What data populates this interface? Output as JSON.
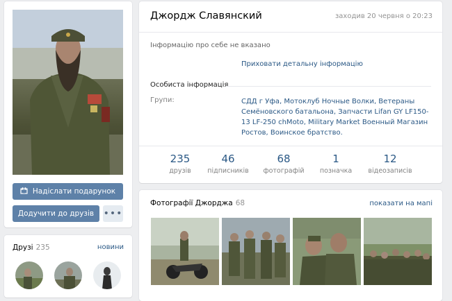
{
  "profile": {
    "name": "Джордж Славянский",
    "last_seen": "заходив 20 червня о 20:23",
    "no_info": "Інформацію про себе не вказано",
    "hide_details": "Приховати детальну інформацію",
    "personal_title": "Особиста інформація",
    "groups_label": "Групи:",
    "groups_value": "СДД г Уфа, Мотоклуб Ночные Волки, Ветераны Семёновского батальона, Запчасти Lifan GY LF150-13 LF-250 chMoto, Military Market Военный Магазин Ростов, Воинское братство."
  },
  "counters": [
    {
      "value": "235",
      "label": "друзів"
    },
    {
      "value": "46",
      "label": "підписників"
    },
    {
      "value": "68",
      "label": "фотографій"
    },
    {
      "value": "1",
      "label": "позначка"
    },
    {
      "value": "12",
      "label": "відеозаписів"
    }
  ],
  "actions": {
    "gift": "Надіслати подарунок",
    "add_friend": "Додучити до друзів",
    "more": "•••"
  },
  "friends": {
    "title": "Друзі",
    "count": "235",
    "new_link": "новини"
  },
  "photos": {
    "title": "Фотографії Джорджа",
    "count": "68",
    "map_link": "показати на мапі"
  },
  "icons": {
    "gift": "gift-icon",
    "more": "more-icon"
  },
  "colors": {
    "accent": "#5e81a8",
    "link": "#2a5885",
    "background": "#edeef0"
  }
}
